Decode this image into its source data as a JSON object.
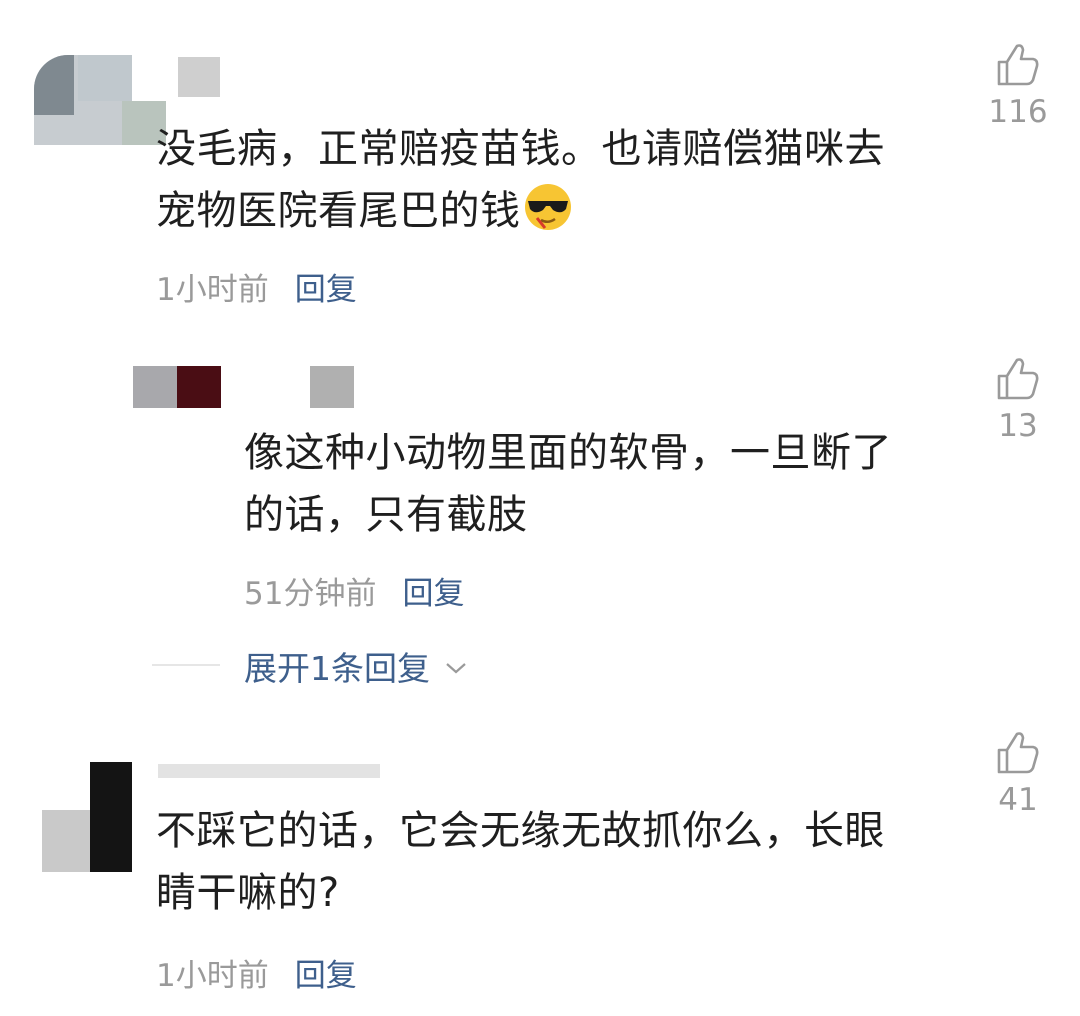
{
  "comments": [
    {
      "text_line1": "没毛病，正常赔疫苗钱。也请赔偿猫咪去",
      "text_line2": "宠物医院看尾巴的钱",
      "emoji": "cool-sunglasses-emoji",
      "time": "1小时前",
      "reply_label": "回复",
      "likes": "116"
    },
    {
      "text_line1": "像这种小动物里面的软骨，一旦断了",
      "text_line2": "的话，只有截肢",
      "time": "51分钟前",
      "reply_label": "回复",
      "likes": "13",
      "expand_label": "展开1条回复"
    },
    {
      "text_line1": "不踩它的话，它会无缘无故抓你么，长眼",
      "text_line2": "睛干嘛的?",
      "time": "1小时前",
      "reply_label": "回复",
      "likes": "41"
    }
  ],
  "icons": {
    "like": "thumbs-up-icon",
    "expand": "chevron-down-icon"
  },
  "colors": {
    "link": "#3e5f8c",
    "meta": "#9a9a9a",
    "text": "#1f1f1f"
  }
}
